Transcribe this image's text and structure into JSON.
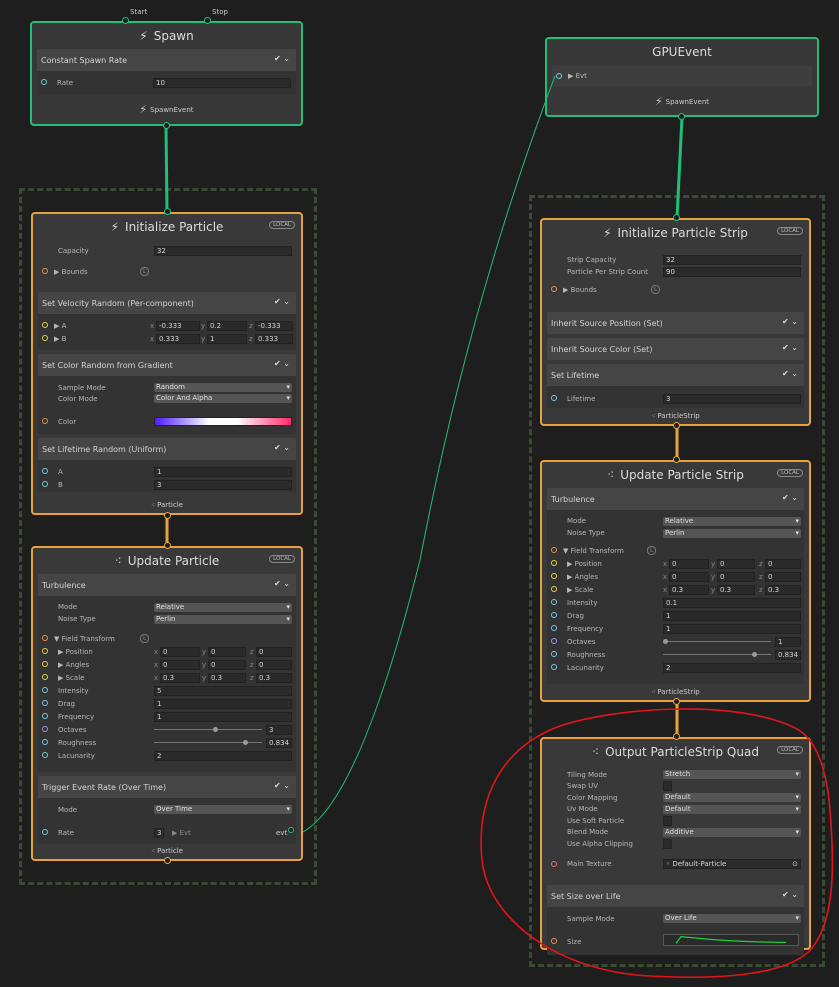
{
  "spawn_node": {
    "start_label": "Start",
    "stop_label": "Stop",
    "title": "Spawn",
    "block": "Constant Spawn Rate",
    "rate_label": "Rate",
    "rate_value": "10",
    "output": "SpawnEvent"
  },
  "gpuevent_node": {
    "title": "GPUEvent",
    "evt_label": "▶ Evt",
    "output": "SpawnEvent"
  },
  "init_particle": {
    "title": "Initialize Particle",
    "badge": "LOCAL",
    "capacity_label": "Capacity",
    "capacity_value": "32",
    "bounds_label": "▶ Bounds",
    "bounds_badge": "L",
    "velocity_block": "Set Velocity Random (Per-component)",
    "a_label": "▶ A",
    "a_x": "-0.333",
    "a_y": "0.2",
    "a_z": "-0.333",
    "b_label": "▶ B",
    "b_x": "0.333",
    "b_y": "1",
    "b_z": "0.333",
    "color_block": "Set Color Random from Gradient",
    "sample_mode_label": "Sample Mode",
    "sample_mode_value": "Random",
    "color_mode_label": "Color Mode",
    "color_mode_value": "Color And Alpha",
    "color_label": "Color",
    "lifetime_block": "Set Lifetime Random (Uniform)",
    "la_label": "A",
    "la_value": "1",
    "lb_label": "B",
    "lb_value": "3",
    "output": "Particle"
  },
  "update_particle": {
    "title": "Update Particle",
    "badge": "LOCAL",
    "turbulence": "Turbulence",
    "mode_label": "Mode",
    "mode_value": "Relative",
    "noise_label": "Noise Type",
    "noise_value": "Perlin",
    "field_label": "▼ Field Transform",
    "field_badge": "L",
    "position_label": "▶ Position",
    "pos_x": "0",
    "pos_y": "0",
    "pos_z": "0",
    "angles_label": "▶ Angles",
    "ang_x": "0",
    "ang_y": "0",
    "ang_z": "0",
    "scale_label": "▶ Scale",
    "sc_x": "0.3",
    "sc_y": "0.3",
    "sc_z": "0.3",
    "intensity_label": "Intensity",
    "intensity_value": "5",
    "drag_label": "Drag",
    "drag_value": "1",
    "frequency_label": "Frequency",
    "frequency_value": "1",
    "octaves_label": "Octaves",
    "octaves_value": "3",
    "roughness_label": "Roughness",
    "roughness_value": "0.834",
    "lacunarity_label": "Lacunarity",
    "lacunarity_value": "2",
    "trigger_block": "Trigger Event Rate (Over Time)",
    "tmode_label": "Mode",
    "tmode_value": "Over Time",
    "rate_label": "Rate",
    "rate_value": "3",
    "evt_label": "▶ Evt",
    "evt_out": "evt",
    "output": "Particle"
  },
  "init_strip": {
    "title": "Initialize Particle Strip",
    "badge": "LOCAL",
    "strip_capacity_label": "Strip Capacity",
    "strip_capacity_value": "32",
    "ppsc_label": "Particle Per Strip Count",
    "ppsc_value": "90",
    "bounds_label": "▶ Bounds",
    "bounds_badge": "L",
    "inherit_pos": "Inherit Source Position (Set)",
    "inherit_color": "Inherit Source Color (Set)",
    "set_lifetime": "Set Lifetime",
    "lifetime_label": "Lifetime",
    "lifetime_value": "3",
    "output": "ParticleStrip"
  },
  "update_strip": {
    "title": "Update Particle Strip",
    "badge": "LOCAL",
    "turbulence": "Turbulence",
    "mode_label": "Mode",
    "mode_value": "Relative",
    "noise_label": "Noise Type",
    "noise_value": "Perlin",
    "field_label": "▼ Field Transform",
    "field_badge": "L",
    "position_label": "▶ Position",
    "pos_x": "0",
    "pos_y": "0",
    "pos_z": "0",
    "angles_label": "▶ Angles",
    "ang_x": "0",
    "ang_y": "0",
    "ang_z": "0",
    "scale_label": "▶ Scale",
    "sc_x": "0.3",
    "sc_y": "0.3",
    "sc_z": "0.3",
    "intensity_label": "Intensity",
    "intensity_value": "0.1",
    "drag_label": "Drag",
    "drag_value": "1",
    "frequency_label": "Frequency",
    "frequency_value": "1",
    "octaves_label": "Octaves",
    "octaves_value": "1",
    "roughness_label": "Roughness",
    "roughness_value": "0.834",
    "lacunarity_label": "Lacunarity",
    "lacunarity_value": "2",
    "output": "ParticleStrip"
  },
  "output_strip": {
    "title": "Output ParticleStrip Quad",
    "badge": "LOCAL",
    "tiling_label": "Tiling Mode",
    "tiling_value": "Stretch",
    "swap_label": "Swap UV",
    "color_mapping_label": "Color Mapping",
    "color_mapping_value": "Default",
    "uv_mode_label": "Uv Mode",
    "uv_mode_value": "Default",
    "soft_label": "Use Soft Particle",
    "blend_label": "Blend Mode",
    "blend_value": "Additive",
    "alpha_clip_label": "Use Alpha Clipping",
    "main_tex_label": "Main Texture",
    "main_tex_value": "Default-Particle",
    "size_block": "Set Size over Life",
    "sample_label": "Sample Mode",
    "sample_value": "Over Life",
    "size_label": "Size"
  },
  "xyz": {
    "x": "x",
    "y": "y",
    "z": "z"
  },
  "colors": {
    "flow": "#1fbf7a",
    "context": "#e8a23c",
    "annotation": "#e0151b"
  }
}
